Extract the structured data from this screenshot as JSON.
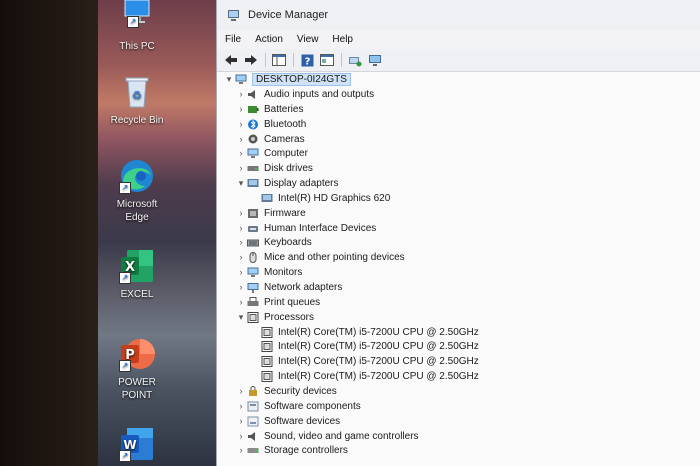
{
  "desktop": {
    "icons": [
      {
        "label": "This PC"
      },
      {
        "label": "Recycle Bin"
      },
      {
        "label": "Microsoft Edge"
      },
      {
        "label": "EXCEL"
      },
      {
        "label": "POWER POINT"
      },
      {
        "label": ""
      }
    ]
  },
  "window": {
    "title": "Device Manager",
    "menu": [
      "File",
      "Action",
      "View",
      "Help"
    ],
    "tree": {
      "root": "DESKTOP-0I24GTS",
      "categories": [
        {
          "label": "Audio inputs and outputs",
          "icon": "speaker-icon",
          "expanded": false
        },
        {
          "label": "Batteries",
          "icon": "battery-icon",
          "expanded": false
        },
        {
          "label": "Bluetooth",
          "icon": "bluetooth-icon",
          "expanded": false
        },
        {
          "label": "Cameras",
          "icon": "camera-icon",
          "expanded": false
        },
        {
          "label": "Computer",
          "icon": "monitor-icon",
          "expanded": false
        },
        {
          "label": "Disk drives",
          "icon": "disk-drive-icon",
          "expanded": false
        },
        {
          "label": "Display adapters",
          "icon": "display-adapter-icon",
          "expanded": true,
          "children": [
            "Intel(R) HD Graphics 620"
          ]
        },
        {
          "label": "Firmware",
          "icon": "firmware-icon",
          "expanded": false
        },
        {
          "label": "Human Interface Devices",
          "icon": "hid-icon",
          "expanded": false
        },
        {
          "label": "Keyboards",
          "icon": "keyboard-icon",
          "expanded": false
        },
        {
          "label": "Mice and other pointing devices",
          "icon": "mouse-icon",
          "expanded": false
        },
        {
          "label": "Monitors",
          "icon": "monitor-icon",
          "expanded": false
        },
        {
          "label": "Network adapters",
          "icon": "network-adapter-icon",
          "expanded": false
        },
        {
          "label": "Print queues",
          "icon": "printer-icon",
          "expanded": false
        },
        {
          "label": "Processors",
          "icon": "processor-icon",
          "expanded": true,
          "children": [
            "Intel(R) Core(TM) i5-7200U CPU @ 2.50GHz",
            "Intel(R) Core(TM) i5-7200U CPU @ 2.50GHz",
            "Intel(R) Core(TM) i5-7200U CPU @ 2.50GHz",
            "Intel(R) Core(TM) i5-7200U CPU @ 2.50GHz"
          ]
        },
        {
          "label": "Security devices",
          "icon": "security-device-icon",
          "expanded": false
        },
        {
          "label": "Software components",
          "icon": "software-component-icon",
          "expanded": false
        },
        {
          "label": "Software devices",
          "icon": "software-device-icon",
          "expanded": false
        },
        {
          "label": "Sound, video and game controllers",
          "icon": "speaker-icon",
          "expanded": false
        },
        {
          "label": "Storage controllers",
          "icon": "storage-controller-icon",
          "expanded": false
        }
      ]
    }
  },
  "colors": {
    "selection": "#cfe2f7",
    "accent": "#1a73c8"
  }
}
